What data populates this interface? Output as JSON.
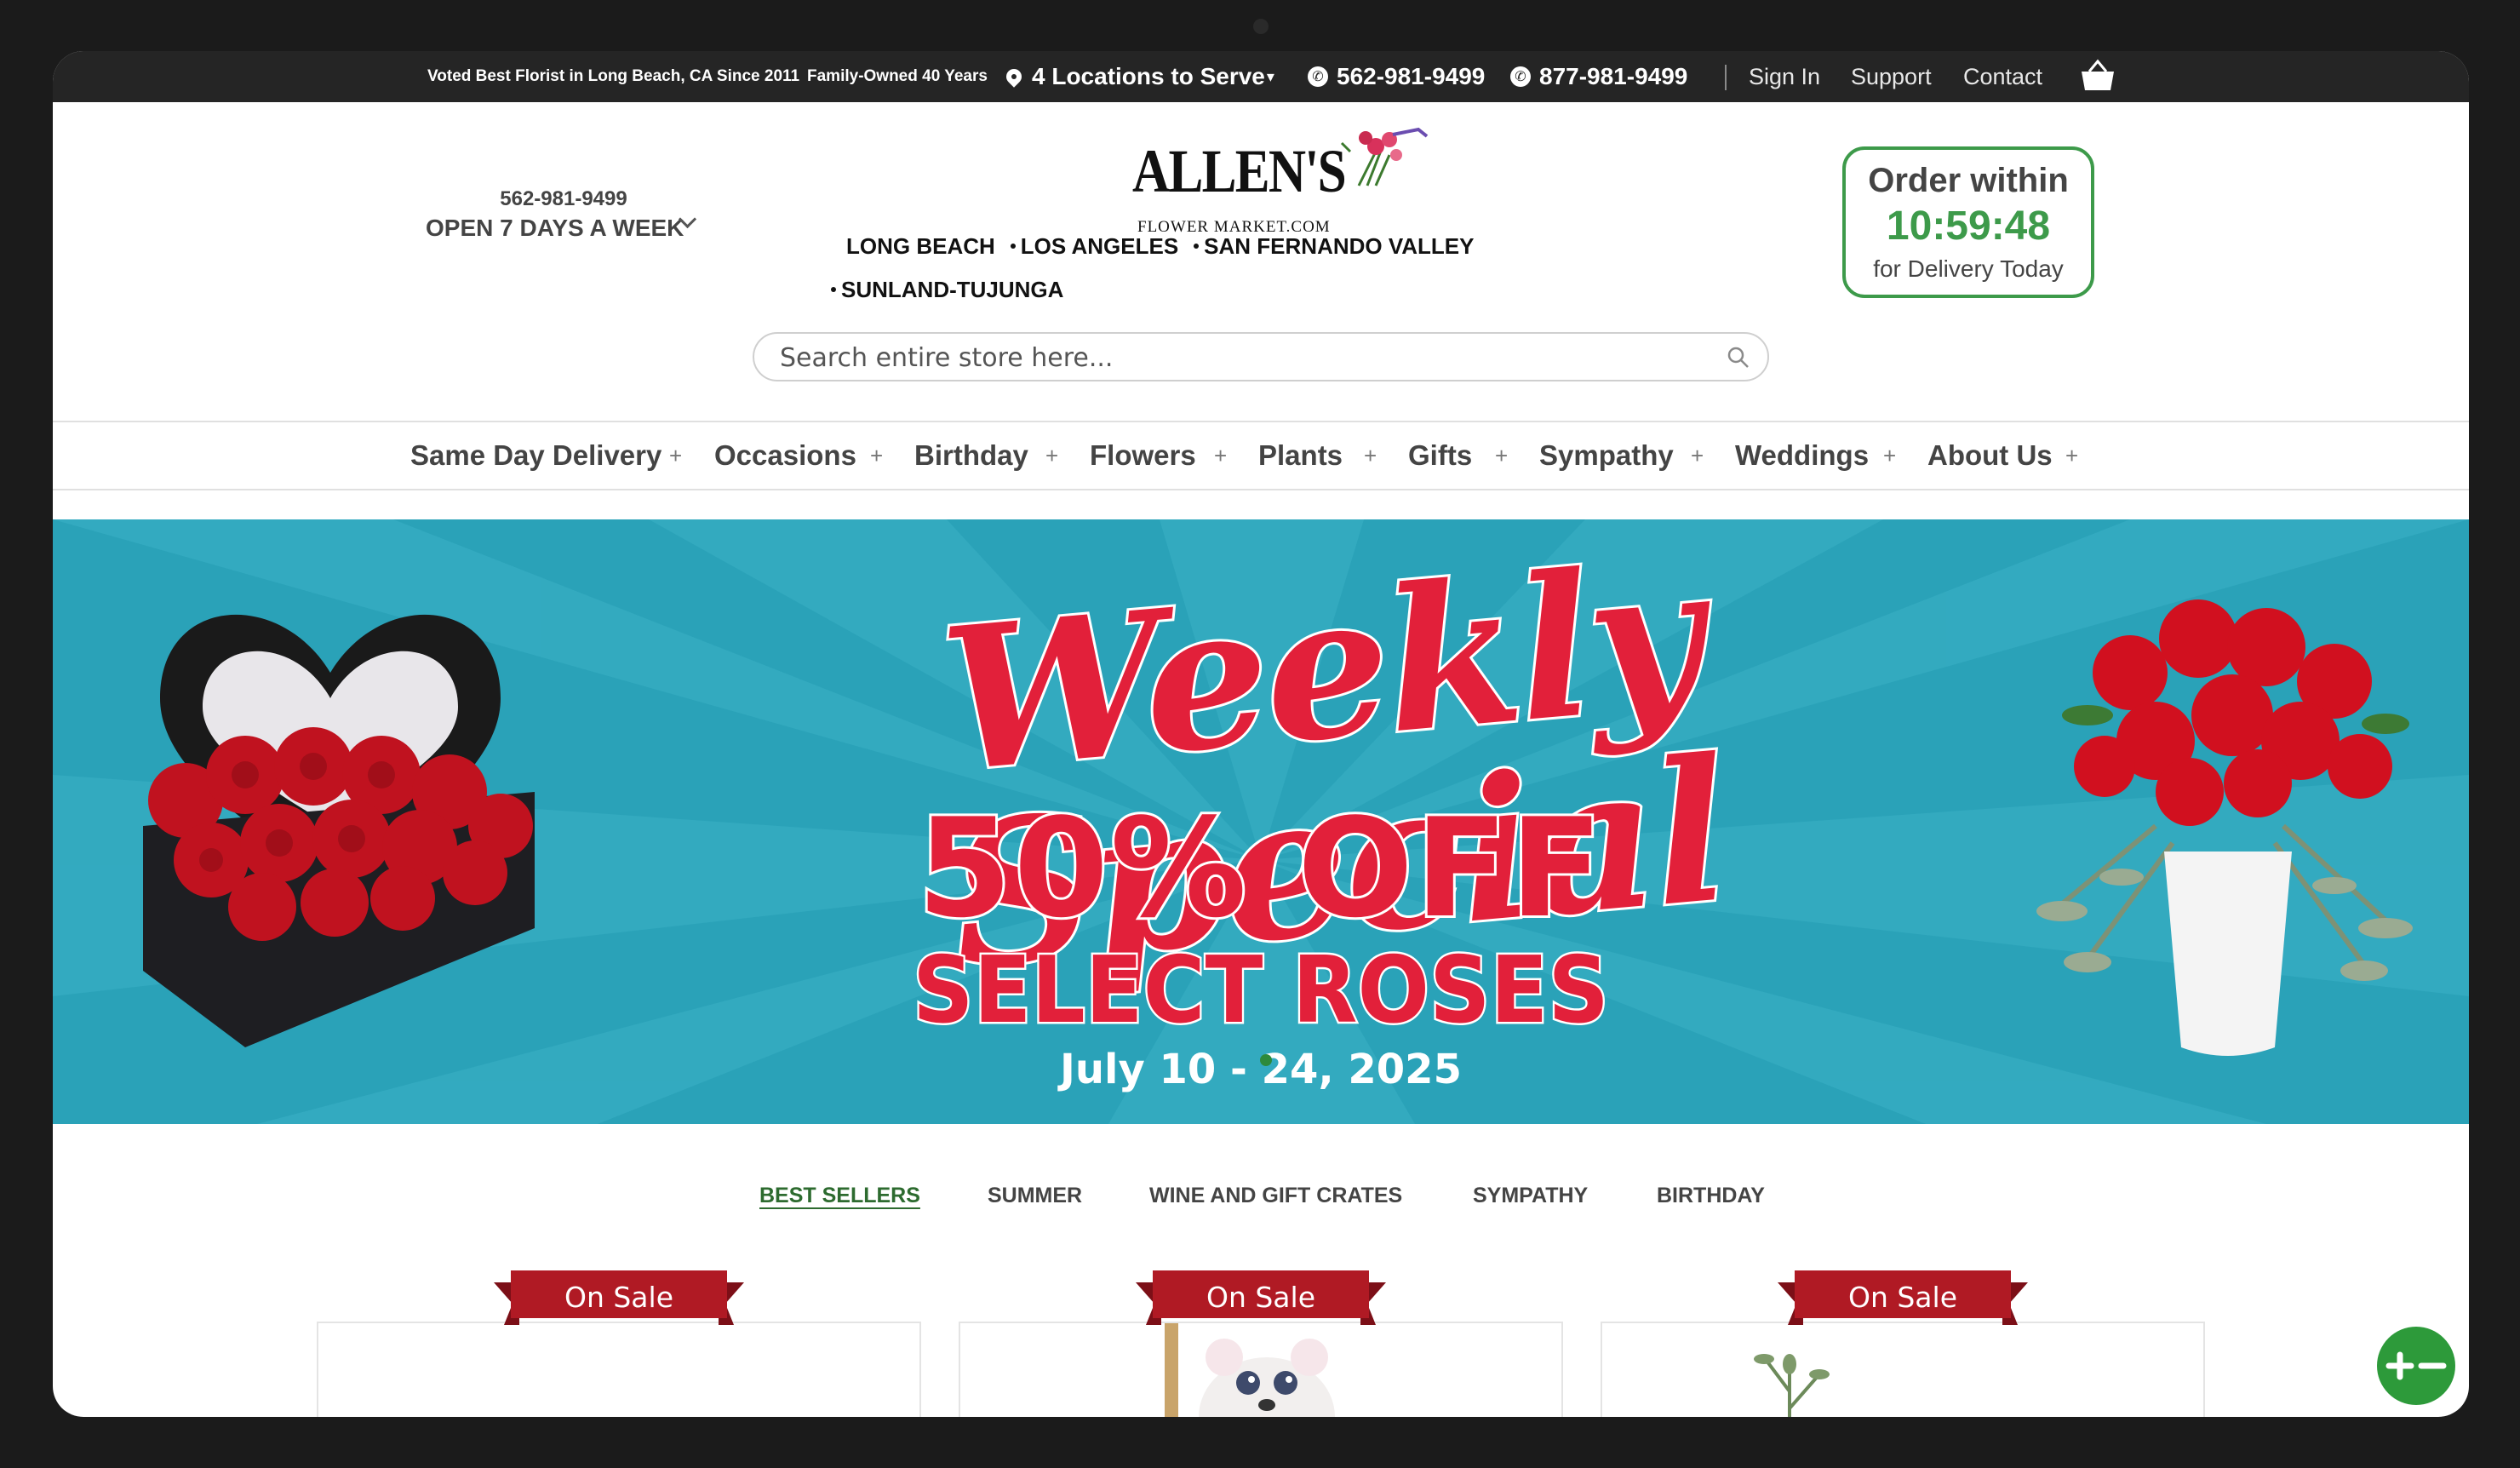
{
  "topbar": {
    "voted": "Voted Best Florist in Long Beach, CA Since 2011",
    "family": "Family-Owned 40 Years",
    "locations": "4 Locations to Serve",
    "phone1": "562-981-9499",
    "phone2": "877-981-9499",
    "sign_in": "Sign In",
    "support": "Support",
    "contact": "Contact"
  },
  "header": {
    "phone": "562-981-9499",
    "hours": "OPEN 7 DAYS A WEEK",
    "logo_word": "ALLEN'S",
    "logo_sub": "FLOWER MARKET.COM",
    "locations": [
      "LONG BEACH",
      "LOS ANGELES",
      "SAN FERNANDO VALLEY",
      "SUNLAND-TUJUNGA"
    ],
    "search_placeholder": "Search entire store here...",
    "order": {
      "line1": "Order within",
      "time": "10:59:48",
      "line3": "for Delivery Today"
    }
  },
  "nav": [
    "Same Day Delivery",
    "Occasions",
    "Birthday",
    "Flowers",
    "Plants",
    "Gifts",
    "Sympathy",
    "Weddings",
    "About Us"
  ],
  "banner": {
    "title": "Weekly Special",
    "offer": "50% OFF",
    "subtitle": "SELECT ROSES",
    "dates": "July 10 - 24, 2025"
  },
  "tabs": [
    "BEST SELLERS",
    "SUMMER",
    "WINE AND GIFT CRATES",
    "SYMPATHY",
    "BIRTHDAY"
  ],
  "products": [
    {
      "badge": "On Sale"
    },
    {
      "badge": "On Sale"
    },
    {
      "badge": "On Sale"
    }
  ],
  "colors": {
    "accent_green": "#3d9a4a",
    "banner_bg": "#2aa2b8",
    "banner_red": "#e2203a",
    "ribbon_red": "#b01a24",
    "topbar_bg": "#252525"
  },
  "icons": [
    "location-pin-icon",
    "phone-icon",
    "cart-icon",
    "search-icon",
    "chevron-down-icon",
    "plus-icon",
    "zoom-toggle-icon"
  ]
}
